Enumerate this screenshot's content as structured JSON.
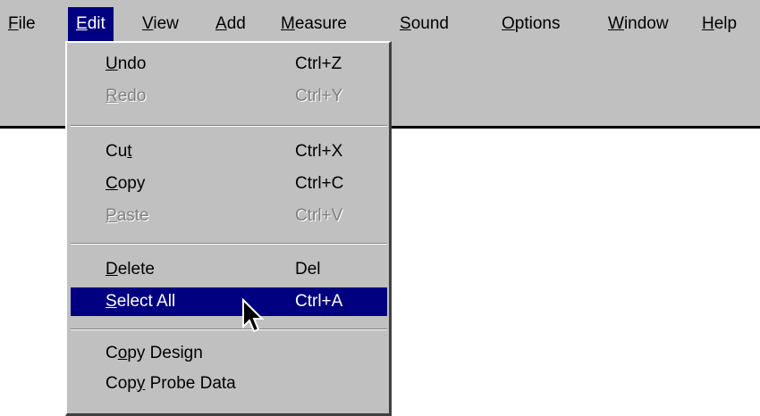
{
  "menubar": {
    "items": [
      {
        "pre": "",
        "key": "F",
        "post": "ile"
      },
      {
        "pre": "",
        "key": "E",
        "post": "dit"
      },
      {
        "pre": "",
        "key": "V",
        "post": "iew"
      },
      {
        "pre": "",
        "key": "A",
        "post": "dd"
      },
      {
        "pre": "",
        "key": "M",
        "post": "easure"
      },
      {
        "pre": "",
        "key": "S",
        "post": "ound"
      },
      {
        "pre": "",
        "key": "O",
        "post": "ptions"
      },
      {
        "pre": "",
        "key": "W",
        "post": "indow"
      },
      {
        "pre": "",
        "key": "H",
        "post": "elp"
      }
    ],
    "active_item": "Edit"
  },
  "edit_menu": {
    "items": [
      {
        "pre": "",
        "key": "U",
        "post": "ndo",
        "shortcut": "Ctrl+Z",
        "state": "enabled"
      },
      {
        "pre": "",
        "key": "R",
        "post": "edo",
        "shortcut": "Ctrl+Y",
        "state": "disabled"
      },
      {
        "pre": "Cu",
        "key": "t",
        "post": "",
        "shortcut": "Ctrl+X",
        "state": "enabled"
      },
      {
        "pre": "",
        "key": "C",
        "post": "opy",
        "shortcut": "Ctrl+C",
        "state": "enabled"
      },
      {
        "pre": "",
        "key": "P",
        "post": "aste",
        "shortcut": "Ctrl+V",
        "state": "disabled"
      },
      {
        "pre": "",
        "key": "D",
        "post": "elete",
        "shortcut": "Del",
        "state": "enabled"
      },
      {
        "pre": "",
        "key": "S",
        "post": "elect All",
        "shortcut": "Ctrl+A",
        "state": "selected"
      },
      {
        "pre": "C",
        "key": "o",
        "post": "py Design",
        "shortcut": "",
        "state": "enabled"
      },
      {
        "pre": "Cop",
        "key": "y",
        "post": " Probe Data",
        "shortcut": "",
        "state": "enabled"
      }
    ]
  },
  "colors": {
    "menu_face": "#c0c0c0",
    "highlight": "#000080",
    "highlight_text": "#ffffff",
    "disabled_text": "#808080"
  },
  "cursor": {
    "icon": "arrow-pointer-icon"
  }
}
